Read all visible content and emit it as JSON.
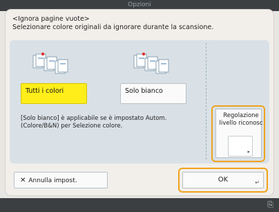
{
  "header": {
    "title": "Opzioni"
  },
  "dialog": {
    "title": "<Ignora pagine vuote>",
    "instruction": "Selezionare colore originali da ignorare durante la scansione."
  },
  "options": [
    {
      "label": "Tutti i colori",
      "selected": true,
      "icon": "multi-doc-color-icon"
    },
    {
      "label": "Solo bianco",
      "selected": false,
      "icon": "multi-doc-white-icon"
    }
  ],
  "note": {
    "line1": "[Solo bianco] è applicabile se è impostato Autom.",
    "line2": "(Colore/B&N) per Selezione colore."
  },
  "adjust": {
    "label_line1": "Regolazione",
    "label_line2": "livello riconosc"
  },
  "footer": {
    "cancel_label": "Annulla impost.",
    "ok_label": "OK"
  },
  "colors": {
    "selected": "#ffee1a",
    "highlight": "#f0a21b",
    "panel": "#d9e1e7"
  }
}
